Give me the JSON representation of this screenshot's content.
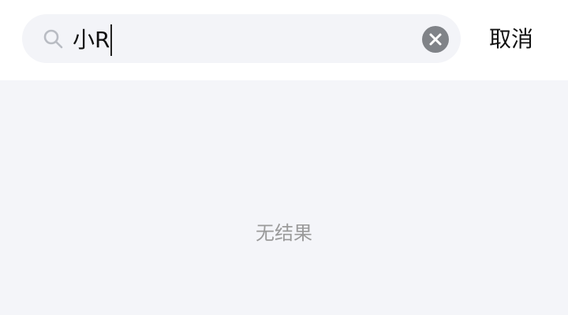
{
  "search": {
    "query": "小R",
    "icons": {
      "search": "search-icon",
      "clear": "clear-icon"
    }
  },
  "header": {
    "cancel_label": "取消"
  },
  "results": {
    "empty_text": "无结果"
  },
  "colors": {
    "header_bg": "#ffffff",
    "search_bg": "#f3f4f8",
    "page_bg": "#f4f5f9",
    "empty_text": "#9a9a9a",
    "clear_icon_bg": "#808388"
  }
}
